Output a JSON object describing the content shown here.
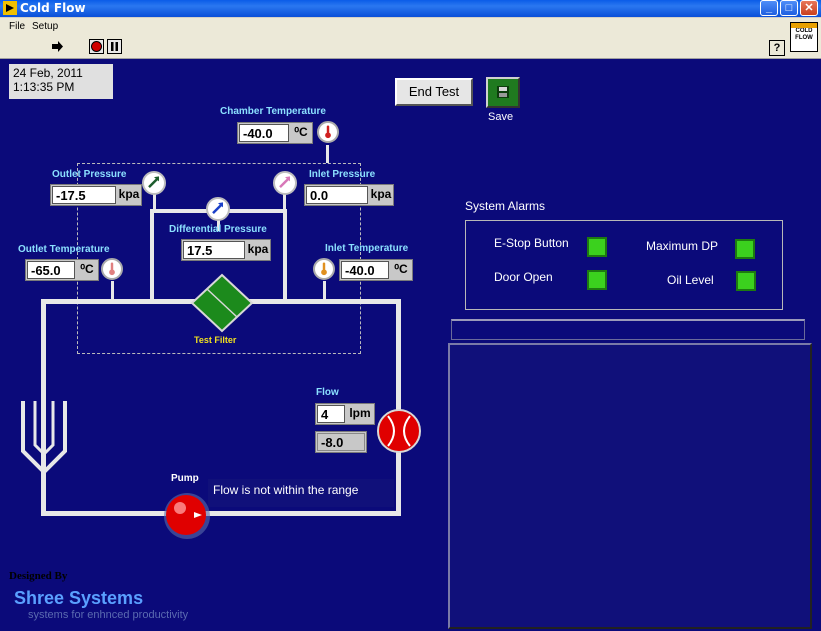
{
  "window": {
    "title": "Cold Flow"
  },
  "menu": [
    "File",
    "Setup"
  ],
  "vi_icon_text": [
    "COLD",
    "FLOW"
  ],
  "header": {
    "date": "24 Feb, 2011",
    "time": "1:13:35 PM",
    "end_test": "End Test",
    "save": "Save"
  },
  "chamber": {
    "label": "Chamber Temperature",
    "value": "-40.0",
    "unit": "⁰C"
  },
  "outlet_pressure": {
    "label": "Outlet Pressure",
    "value": "-17.5",
    "unit": "kpa"
  },
  "inlet_pressure": {
    "label": "Inlet Pressure",
    "value": "0.0",
    "unit": "kpa"
  },
  "diff_pressure": {
    "label": "Differential Pressure",
    "value": "17.5",
    "unit": "kpa"
  },
  "outlet_temp": {
    "label": "Outlet Temperature",
    "value": "-65.0",
    "unit": "⁰C"
  },
  "inlet_temp": {
    "label": "Inlet Temperature",
    "value": "-40.0",
    "unit": "⁰C"
  },
  "filter": {
    "label": "Test Filter"
  },
  "flow": {
    "label": "Flow",
    "value": "4",
    "unit": "lpm",
    "reading": "-8.0"
  },
  "pump": {
    "label": "Pump",
    "message": "Flow is not within the range"
  },
  "alarms": {
    "title": "System Alarms",
    "items": [
      {
        "label": "E-Stop Button",
        "color": "#3bd11e"
      },
      {
        "label": "Maximum DP",
        "color": "#3bd11e"
      },
      {
        "label": "Door Open",
        "color": "#3bd11e"
      },
      {
        "label": "Oil Level",
        "color": "#3bd11e"
      }
    ]
  },
  "footer": {
    "designed_by": "Designed By",
    "company": "Shree Systems",
    "tagline": "systems for enhnced productivity"
  },
  "colors": {
    "panel": "#0b0a7a",
    "label": "#8be0ff",
    "led_green": "#3bd11e",
    "pump_red": "#e00000",
    "filter_green": "#1c8a1c"
  }
}
